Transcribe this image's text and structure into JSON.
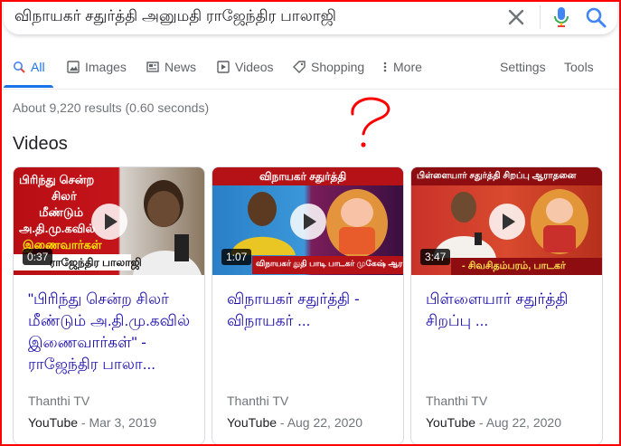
{
  "search": {
    "query": "விநாயகர் சதுர்த்தி அனுமதி ராஜேந்திர பாலாஜி"
  },
  "tabs": [
    {
      "label": "All",
      "icon": "search-icon"
    },
    {
      "label": "Images",
      "icon": "image-icon"
    },
    {
      "label": "News",
      "icon": "news-icon"
    },
    {
      "label": "Videos",
      "icon": "play-icon"
    },
    {
      "label": "Shopping",
      "icon": "tag-icon"
    },
    {
      "label": "More",
      "icon": "more-vert-icon"
    }
  ],
  "tools": {
    "settings": "Settings",
    "tools": "Tools"
  },
  "result_stats": "About 9,220 results (0.60 seconds)",
  "videos_heading": "Videos",
  "videos": [
    {
      "title": "\"பிரிந்து சென்ற சிலர் மீண்டும் அ.தி.மு.கவில் இணைவார்கள்\" - ராஜேந்திர பாலா...",
      "duration": "0:37",
      "channel": "Thanthi TV",
      "source": "YouTube",
      "date": "Mar 3, 2019",
      "thumb_lines": [
        "பிரிந்து சென்ற",
        "சிலர்",
        "மீண்டும்",
        "அ.தி.மு.கவில்",
        "இணைவார்கள்"
      ],
      "thumb_caption": "ராஜேந்திர பாலாஜி"
    },
    {
      "title": "விநாயகர் சதுர்த்தி - விநாயகர் ...",
      "duration": "1:07",
      "channel": "Thanthi TV",
      "source": "YouTube",
      "date": "Aug 22, 2020",
      "thumb_header": "விநாயகர் சதுர்த்தி",
      "thumb_caption": "விநாயகர் துதி பாடி பாடகர் முகேஷ் ஆராதனை"
    },
    {
      "title": "பிள்ளையார் சதுர்த்தி சிறப்பு ...",
      "duration": "3:47",
      "channel": "Thanthi TV",
      "source": "YouTube",
      "date": "Aug 22, 2020",
      "thumb_header": "பிள்ளையார் சதுர்த்தி சிறப்பு ஆராதனை",
      "thumb_caption": "- சிவசிதம்பரம், பாடகர்"
    }
  ],
  "colors": {
    "link": "#1a0dab",
    "accent": "#1a73e8",
    "annotation": "#ff0000"
  }
}
